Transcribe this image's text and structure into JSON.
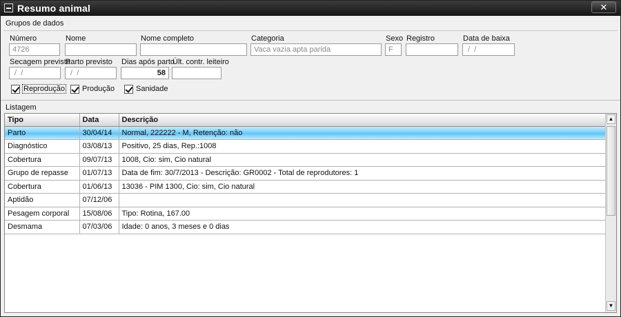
{
  "window": {
    "title": "Resumo animal",
    "close_label": "✕"
  },
  "groups": {
    "title": "Grupos de dados",
    "fields": {
      "numero": {
        "label": "Número",
        "value": "4726"
      },
      "nome": {
        "label": "Nome",
        "value": ""
      },
      "nome_completo": {
        "label": "Nome completo",
        "value": ""
      },
      "categoria": {
        "label": "Categoria",
        "value": "Vaca vazia apta parida"
      },
      "sexo": {
        "label": "Sexo",
        "value": "F"
      },
      "registro": {
        "label": "Registro",
        "value": ""
      },
      "data_baixa": {
        "label": "Data de baixa",
        "value": " /  /"
      },
      "secagem": {
        "label": "Secagem prevista",
        "value": " /  /"
      },
      "parto": {
        "label": "Parto previsto",
        "value": " /  /"
      },
      "dias_parto": {
        "label": "Dias após parto",
        "value": "58"
      },
      "ult_contr": {
        "label": "Últ. contr. leiteiro",
        "value": ""
      }
    },
    "checks": {
      "reproducao": {
        "label": "Reprodução",
        "checked": true
      },
      "producao": {
        "label": "Produção",
        "checked": true
      },
      "sanidade": {
        "label": "Sanidade",
        "checked": true
      }
    }
  },
  "list": {
    "title": "Listagem",
    "columns": [
      "Tipo",
      "Data",
      "Descrição"
    ],
    "rows": [
      {
        "tipo": "Parto",
        "data": "30/04/14",
        "descricao": "Normal, 222222 - M, Retenção: não"
      },
      {
        "tipo": "Diagnóstico",
        "data": "03/08/13",
        "descricao": "Positivo, 25 dias, Rep.:1008"
      },
      {
        "tipo": "Cobertura",
        "data": "09/07/13",
        "descricao": "1008, Cio: sim, Cio natural"
      },
      {
        "tipo": "Grupo de repasse",
        "data": "01/07/13",
        "descricao": "Data de fim: 30/7/2013 - Descrição: GR0002 - Total de reprodutores: 1"
      },
      {
        "tipo": "Cobertura",
        "data": "01/06/13",
        "descricao": "13036 - PIM 1300, Cio: sim, Cio natural"
      },
      {
        "tipo": "Aptidão",
        "data": "07/12/06",
        "descricao": ""
      },
      {
        "tipo": "Pesagem corporal",
        "data": "15/08/06",
        "descricao": "Tipo: Rotina, 167.00"
      },
      {
        "tipo": "Desmama",
        "data": "07/03/06",
        "descricao": "Idade: 0 anos, 3 meses e 0 dias"
      }
    ],
    "selected_row": 0,
    "scroll_up": "▲",
    "scroll_down": "▼"
  }
}
